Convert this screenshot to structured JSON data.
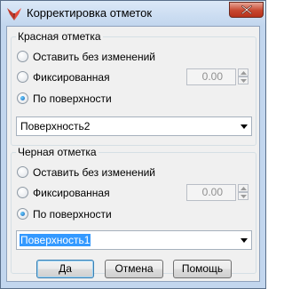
{
  "window": {
    "title": "Корректировка отметок"
  },
  "red_group": {
    "legend": "Красная отметка",
    "options": [
      {
        "label": "Оставить без изменений",
        "checked": false
      },
      {
        "label": "Фиксированная",
        "checked": false
      },
      {
        "label": "По поверхности",
        "checked": true
      }
    ],
    "fixed_value": "0.00",
    "surface_value": "Поверхность2"
  },
  "black_group": {
    "legend": "Черная отметка",
    "options": [
      {
        "label": "Оставить без изменений",
        "checked": false
      },
      {
        "label": "Фиксированная",
        "checked": false
      },
      {
        "label": "По поверхности",
        "checked": true
      }
    ],
    "fixed_value": "0.00",
    "surface_value": "Поверхность1"
  },
  "buttons": {
    "ok": "Да",
    "cancel": "Отмена",
    "help": "Помощь"
  },
  "icons": {
    "app": "app-logo-icon",
    "close": "close-icon",
    "dropdown": "chevron-down-icon"
  },
  "colors": {
    "title_bar": "#c2d6ee",
    "close_button": "#c7472f",
    "selection": "#3399ff"
  }
}
